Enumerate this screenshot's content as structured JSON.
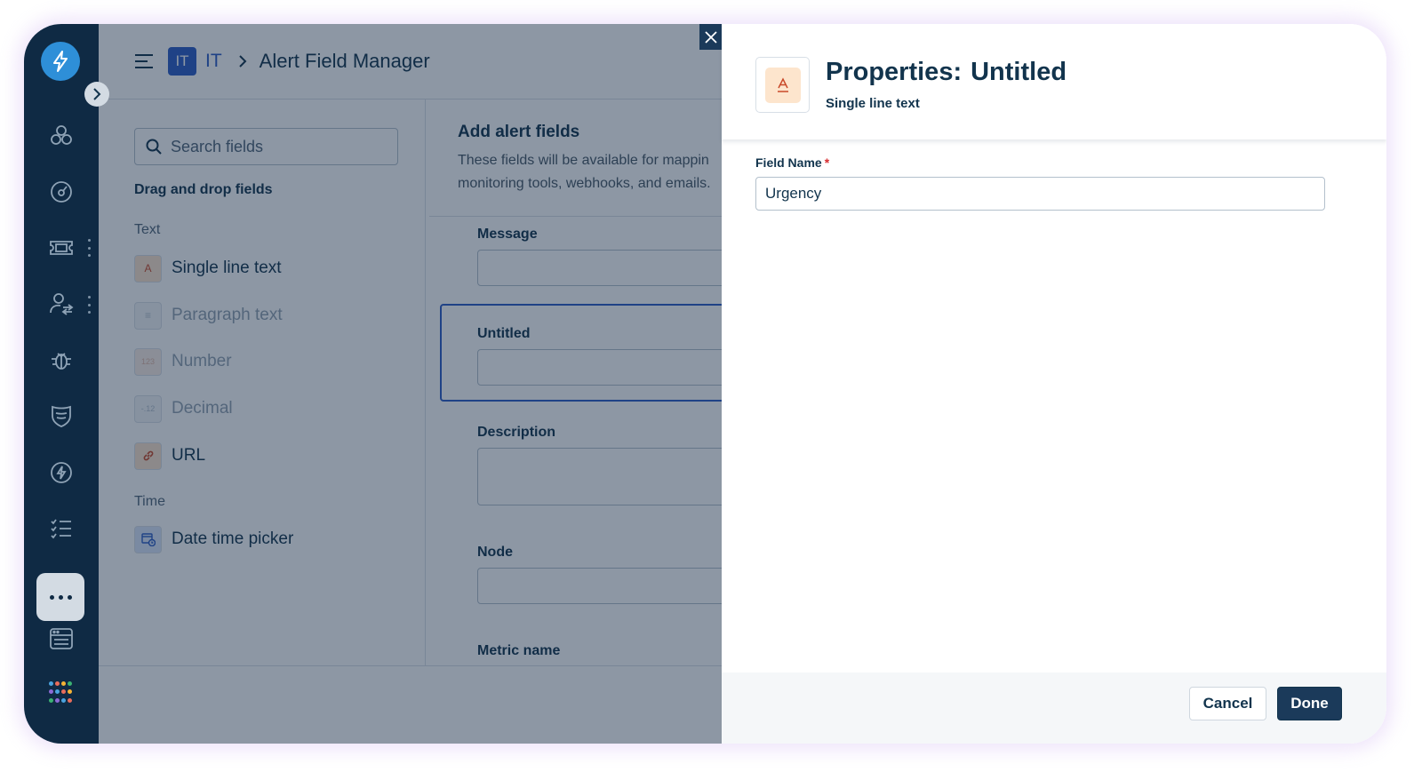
{
  "colors": {
    "sidebar_bg": "#0f2a44",
    "accent_blue": "#2c5cc5",
    "primary_button": "#1b3a5a",
    "required_red": "#d72d30",
    "field_icon_orange": "#fde5cd"
  },
  "sidebar": {
    "items": [
      {
        "icon": "bolt-logo-icon"
      },
      {
        "icon": "circles-icon"
      },
      {
        "icon": "gauge-icon"
      },
      {
        "icon": "ticket-icon"
      },
      {
        "icon": "user-swap-icon"
      },
      {
        "icon": "bug-icon"
      },
      {
        "icon": "shield-icon"
      },
      {
        "icon": "bolt-circle-icon"
      },
      {
        "icon": "checklist-icon"
      },
      {
        "icon": "more-icon"
      },
      {
        "icon": "window-icon"
      },
      {
        "icon": "apps-grid-icon"
      }
    ]
  },
  "header": {
    "workspace_badge": "IT",
    "workspace_name": "IT",
    "page_title": "Alert Field Manager"
  },
  "left_panel": {
    "search_placeholder": "Search fields",
    "heading": "Drag and drop fields",
    "groups": [
      {
        "label": "Text",
        "items": [
          {
            "label": "Single line text",
            "icon": "text-a-icon",
            "icon_text": "A"
          },
          {
            "label": "Paragraph text",
            "icon": "paragraph-icon",
            "icon_text": "≡"
          },
          {
            "label": "Number",
            "icon": "number-icon",
            "icon_text": "123"
          },
          {
            "label": "Decimal",
            "icon": "decimal-icon",
            "icon_text": "-.12"
          },
          {
            "label": "URL",
            "icon": "link-icon",
            "icon_text": ""
          }
        ]
      },
      {
        "label": "Time",
        "items": [
          {
            "label": "Date time picker",
            "icon": "calendar-clock-icon",
            "icon_text": ""
          }
        ]
      }
    ]
  },
  "center_panel": {
    "title": "Add alert fields",
    "description_line1": "These fields will be available for mappin",
    "description_line2": "monitoring tools, webhooks, and emails.",
    "fields": [
      {
        "label": "Message"
      },
      {
        "label": "Untitled"
      },
      {
        "label": "Description"
      },
      {
        "label": "Node"
      },
      {
        "label": "Metric name"
      }
    ]
  },
  "drawer": {
    "title_prefix": "Properties:",
    "title_name": "Untitled",
    "subtitle": "Single line text",
    "field_name_label": "Field Name",
    "required_mark": "*",
    "field_name_value": "Urgency",
    "cancel_label": "Cancel",
    "done_label": "Done"
  }
}
